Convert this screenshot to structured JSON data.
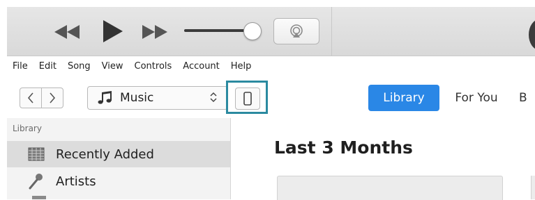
{
  "player": {
    "icons": [
      "rewind-icon",
      "play-icon",
      "fast-forward-icon",
      "volume-slider",
      "airplay-icon",
      "apple-logo-icon"
    ]
  },
  "menu": {
    "items": [
      "File",
      "Edit",
      "Song",
      "View",
      "Controls",
      "Account",
      "Help"
    ]
  },
  "toolbar": {
    "media_label": "Music",
    "tabs": [
      "Library",
      "For You",
      "B"
    ],
    "selected_tab": "Library",
    "accent_color": "#2a87e6",
    "highlight_color": "#2b8aa0"
  },
  "sidebar": {
    "heading": "Library",
    "items": [
      {
        "label": "Recently Added",
        "icon": "grid-icon",
        "selected": true
      },
      {
        "label": "Artists",
        "icon": "microphone-icon",
        "selected": false
      }
    ]
  },
  "main": {
    "title": "Last 3 Months"
  }
}
